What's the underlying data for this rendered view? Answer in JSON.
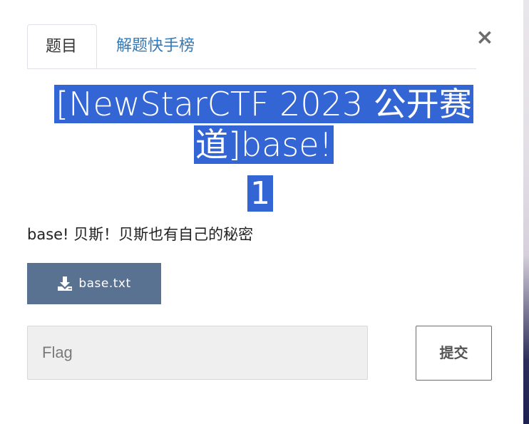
{
  "tabs": {
    "active_label": "题目",
    "second_label": "解题快手榜"
  },
  "close": {
    "label": "×"
  },
  "challenge": {
    "title_line1": "[NewStarCTF 2023 公开赛",
    "title_line2": "道]base!",
    "value": "1",
    "description": "base! 贝斯！贝斯也有自己的秘密"
  },
  "download": {
    "icon": "download-icon",
    "label": "base.txt"
  },
  "flag": {
    "placeholder": "Flag",
    "value": ""
  },
  "submit": {
    "label": "提交"
  },
  "colors": {
    "selection": "#3465d4",
    "tab_link": "#337ab7",
    "download_bg": "#5a7291",
    "input_bg": "#efefef"
  }
}
